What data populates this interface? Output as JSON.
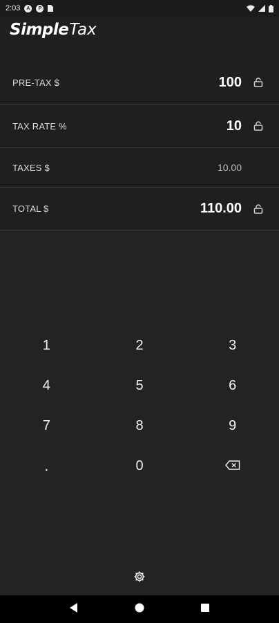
{
  "status_bar": {
    "time": "2:03",
    "icons": [
      "notification-a-icon",
      "notification-p-icon",
      "sim-card-icon",
      "wifi-icon",
      "signal-icon",
      "battery-icon"
    ]
  },
  "app": {
    "logo_bold": "Simple",
    "logo_light": "Tax"
  },
  "rows": {
    "pretax": {
      "label": "PRE-TAX $",
      "value": "100"
    },
    "taxrate": {
      "label": "TAX RATE %",
      "value": "10"
    },
    "taxes": {
      "label": "TAXES $",
      "value": "10.00"
    },
    "total": {
      "label": "TOTAL $",
      "value": "110.00"
    }
  },
  "keypad": {
    "k1": "1",
    "k2": "2",
    "k3": "3",
    "k4": "4",
    "k5": "5",
    "k6": "6",
    "k7": "7",
    "k8": "8",
    "k9": "9",
    "kdot": ".",
    "k0": "0"
  },
  "colors": {
    "background": "#232323",
    "header": "#1f1f1f",
    "divider": "#3c3c3c",
    "navbar": "#000000"
  }
}
